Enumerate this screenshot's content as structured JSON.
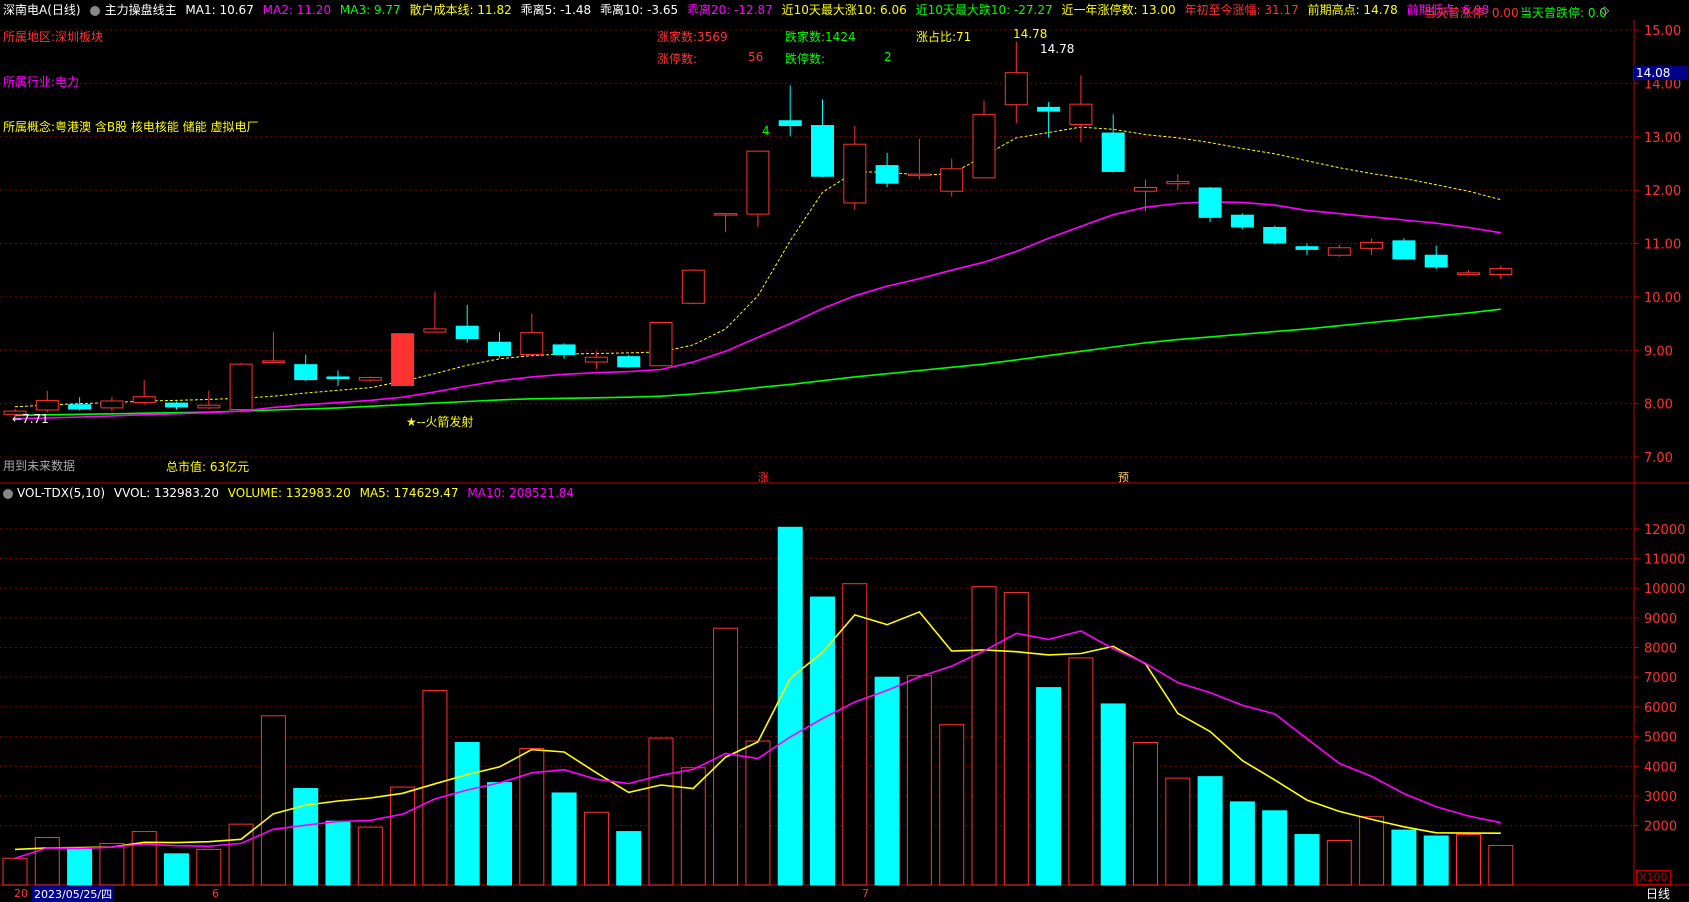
{
  "header": {
    "stock": "深南电A(日线)",
    "indicator": "主力操盘线主",
    "ma1": "MA1: 10.67",
    "ma2": "MA2: 11.20",
    "ma3": "MA3: 9.77",
    "cost": "散户成本线: 11.82",
    "bias5": "乖离5: -1.48",
    "bias10": "乖离10: -3.65",
    "bias20": "乖离20: -12.87",
    "up10": "近10天最大涨10: 6.06",
    "down10": "近10天最大跌10: -27.27",
    "limitup_year": "近一年涨停数: 13.00",
    "ytd": "年初至今涨幅: 31.17",
    "prev_high": "前期高点: 14.78",
    "prev_low": "前期低点: 6.98",
    "today_up": "当天曾涨停: 0.00",
    "today_down": "当天曾跌停: 0.0"
  },
  "info": {
    "region": "所属地区:深圳板块",
    "industry": "所属行业:电力",
    "concept": "所属概念:粤港澳 含B股 核电核能 储能 虚拟电厂",
    "up_count": "涨家数:3569",
    "down_count": "跌家数:1424",
    "ratio": "涨占比:71",
    "limit_up_label": "涨停数:",
    "limit_up_val": "56",
    "limit_down_label": "跌停数:",
    "limit_down_val": "2",
    "future_data": "用到未来数据",
    "market_cap": "总市值: 63亿元",
    "rocket": "★--火箭发射",
    "low_mark": "←7.71",
    "high_mark1": "14.78",
    "high_mark2": "14.78",
    "count4": "4",
    "zhang": "涨",
    "yu": "预",
    "price_tag": "14.08"
  },
  "vol_header": {
    "name": "VOL-TDX(5,10)",
    "vvol": "VVOL: 132983.20",
    "volume": "VOLUME: 132983.20",
    "ma5": "MA5: 174629.47",
    "ma10": "MA10: 208521.84"
  },
  "footer": {
    "date": "2023/05/25/四",
    "year_stub": "20",
    "m6": "6",
    "m7": "7",
    "period": "日线",
    "x100": "X100"
  },
  "colors": {
    "up": "#ff3232",
    "down": "#00ffff",
    "ma2": "#ff00ff",
    "ma3": "#00ff00",
    "cost": "#ffff00",
    "grid": "#800000",
    "axis": "#c00000"
  },
  "chart_data": [
    {
      "type": "candlestick",
      "ylim": [
        6.75,
        15.3
      ],
      "yticks": [
        7.0,
        8.0,
        9.0,
        10.0,
        11.0,
        12.0,
        13.0,
        14.0,
        15.0
      ],
      "candles": [
        {
          "o": 7.8,
          "c": 7.86,
          "h": 7.9,
          "l": 7.75
        },
        {
          "o": 7.88,
          "c": 8.06,
          "h": 8.24,
          "l": 7.84
        },
        {
          "o": 7.98,
          "c": 7.9,
          "h": 8.12,
          "l": 7.87
        },
        {
          "o": 7.92,
          "c": 8.05,
          "h": 8.13,
          "l": 7.86
        },
        {
          "o": 8.02,
          "c": 8.13,
          "h": 8.44,
          "l": 7.98
        },
        {
          "o": 8.01,
          "c": 7.94,
          "h": 8.04,
          "l": 7.89
        },
        {
          "o": 7.92,
          "c": 7.97,
          "h": 8.24,
          "l": 7.9
        },
        {
          "o": 7.89,
          "c": 8.74,
          "h": 8.77,
          "l": 7.83
        },
        {
          "o": 8.78,
          "c": 8.8,
          "h": 9.34,
          "l": 8.78
        },
        {
          "o": 8.73,
          "c": 8.45,
          "h": 8.92,
          "l": 8.42
        },
        {
          "o": 8.5,
          "c": 8.47,
          "h": 8.62,
          "l": 8.33
        },
        {
          "o": 8.44,
          "c": 8.49,
          "h": 8.51,
          "l": 8.41
        },
        {
          "o": 8.34,
          "c": 9.31,
          "h": 9.31,
          "l": 8.34
        },
        {
          "o": 9.34,
          "c": 9.4,
          "h": 10.1,
          "l": 9.34
        },
        {
          "o": 9.45,
          "c": 9.22,
          "h": 9.85,
          "l": 9.14
        },
        {
          "o": 9.15,
          "c": 8.9,
          "h": 9.34,
          "l": 8.86
        },
        {
          "o": 8.92,
          "c": 9.33,
          "h": 9.68,
          "l": 8.88
        },
        {
          "o": 9.1,
          "c": 8.92,
          "h": 9.13,
          "l": 8.84
        },
        {
          "o": 8.78,
          "c": 8.87,
          "h": 8.98,
          "l": 8.65
        },
        {
          "o": 8.88,
          "c": 8.69,
          "h": 8.91,
          "l": 8.67
        },
        {
          "o": 8.71,
          "c": 9.52,
          "h": 9.53,
          "l": 8.71
        },
        {
          "o": 9.88,
          "c": 10.5,
          "h": 10.52,
          "l": 9.86
        },
        {
          "o": 11.55,
          "c": 11.56,
          "h": 11.56,
          "l": 11.21
        },
        {
          "o": 11.55,
          "c": 12.73,
          "h": 12.73,
          "l": 11.31
        },
        {
          "o": 13.3,
          "c": 13.21,
          "h": 13.96,
          "l": 13.01
        },
        {
          "o": 13.21,
          "c": 12.26,
          "h": 13.7,
          "l": 12.24
        },
        {
          "o": 11.76,
          "c": 12.86,
          "h": 13.2,
          "l": 11.63
        },
        {
          "o": 12.46,
          "c": 12.13,
          "h": 12.7,
          "l": 12.06
        },
        {
          "o": 12.28,
          "c": 12.3,
          "h": 12.96,
          "l": 12.2
        },
        {
          "o": 11.98,
          "c": 12.4,
          "h": 12.59,
          "l": 11.88
        },
        {
          "o": 12.23,
          "c": 13.42,
          "h": 13.68,
          "l": 12.22
        },
        {
          "o": 13.6,
          "c": 14.2,
          "h": 14.78,
          "l": 13.25
        },
        {
          "o": 13.55,
          "c": 13.48,
          "h": 13.65,
          "l": 12.98
        },
        {
          "o": 13.23,
          "c": 13.61,
          "h": 14.15,
          "l": 12.9
        },
        {
          "o": 13.07,
          "c": 12.35,
          "h": 13.42,
          "l": 12.33
        },
        {
          "o": 11.98,
          "c": 12.05,
          "h": 12.2,
          "l": 11.6
        },
        {
          "o": 12.12,
          "c": 12.16,
          "h": 12.3,
          "l": 12.0
        },
        {
          "o": 12.04,
          "c": 11.49,
          "h": 12.06,
          "l": 11.4
        },
        {
          "o": 11.53,
          "c": 11.31,
          "h": 11.56,
          "l": 11.27
        },
        {
          "o": 11.3,
          "c": 11.01,
          "h": 11.33,
          "l": 10.98
        },
        {
          "o": 10.94,
          "c": 10.89,
          "h": 11.0,
          "l": 10.78
        },
        {
          "o": 10.78,
          "c": 10.92,
          "h": 10.98,
          "l": 10.75
        },
        {
          "o": 10.91,
          "c": 11.02,
          "h": 11.1,
          "l": 10.78
        },
        {
          "o": 11.05,
          "c": 10.71,
          "h": 11.1,
          "l": 10.7
        },
        {
          "o": 10.78,
          "c": 10.56,
          "h": 10.96,
          "l": 10.52
        },
        {
          "o": 10.45,
          "c": 10.45,
          "h": 10.5,
          "l": 10.42
        },
        {
          "o": 10.42,
          "c": 10.53,
          "h": 10.58,
          "l": 10.33
        }
      ],
      "ma3": [
        7.78,
        7.79,
        7.8,
        7.81,
        7.82,
        7.83,
        7.84,
        7.86,
        7.88,
        7.9,
        7.92,
        7.95,
        7.98,
        8.01,
        8.04,
        8.07,
        8.09,
        8.1,
        8.11,
        8.12,
        8.14,
        8.18,
        8.23,
        8.3,
        8.36,
        8.43,
        8.5,
        8.56,
        8.62,
        8.68,
        8.74,
        8.82,
        8.9,
        8.98,
        9.06,
        9.14,
        9.2,
        9.25,
        9.3,
        9.35,
        9.4,
        9.46,
        9.52,
        9.58,
        9.64,
        9.7,
        9.77
      ],
      "ma2": [
        7.72,
        7.73,
        7.75,
        7.77,
        7.79,
        7.81,
        7.83,
        7.86,
        7.93,
        7.98,
        8.02,
        8.06,
        8.12,
        8.22,
        8.33,
        8.43,
        8.5,
        8.55,
        8.58,
        8.6,
        8.64,
        8.78,
        8.98,
        9.24,
        9.5,
        9.78,
        10.02,
        10.2,
        10.34,
        10.5,
        10.65,
        10.85,
        11.1,
        11.32,
        11.54,
        11.68,
        11.75,
        11.78,
        11.77,
        11.72,
        11.62,
        11.56,
        11.5,
        11.44,
        11.38,
        11.3,
        11.2
      ],
      "cost": [
        7.94,
        7.97,
        8.0,
        8.02,
        8.05,
        8.06,
        8.08,
        8.1,
        8.14,
        8.2,
        8.25,
        8.3,
        8.42,
        8.56,
        8.72,
        8.84,
        8.9,
        8.93,
        8.94,
        8.95,
        8.97,
        9.1,
        9.4,
        10.02,
        11.05,
        11.96,
        12.34,
        12.34,
        12.28,
        12.31,
        12.64,
        12.98,
        13.08,
        13.18,
        13.14,
        13.04,
        12.98,
        12.89,
        12.78,
        12.68,
        12.55,
        12.42,
        12.31,
        12.22,
        12.1,
        11.98,
        11.82
      ]
    },
    {
      "type": "bar",
      "name": "VOL-TDX(5,10)",
      "unit": "X100",
      "ylim": [
        0,
        12700
      ],
      "yticks": [
        2000,
        3000,
        4000,
        5000,
        6000,
        7000,
        8000,
        9000,
        10000,
        11000,
        12000
      ],
      "volumes": [
        900,
        1600,
        1200,
        1400,
        1800,
        1050,
        1200,
        2050,
        5700,
        3250,
        2150,
        1950,
        3300,
        6550,
        4800,
        3450,
        4600,
        3100,
        2450,
        1800,
        4950,
        3950,
        8650,
        4850,
        12050,
        9700,
        10150,
        7000,
        7050,
        5400,
        10050,
        9850,
        6650,
        7650,
        6100,
        4800,
        3600,
        3650,
        2800,
        2500,
        1700,
        1500,
        2300,
        1850,
        1650,
        1700,
        1329.8
      ],
      "ma5": [
        1200,
        1250,
        1260,
        1280,
        1440,
        1430,
        1460,
        1540,
        2400,
        2690,
        2830,
        2930,
        3090,
        3410,
        3720,
        3980,
        4560,
        4480,
        3780,
        3120,
        3370,
        3250,
        4310,
        4820,
        6960,
        7840,
        9100,
        8770,
        9200,
        7880,
        7920,
        7860,
        7750,
        7800,
        8040,
        7450,
        5780,
        5170,
        4190,
        3540,
        2860,
        2480,
        2210,
        1960,
        1760,
        1750,
        1746
      ]
    }
  ]
}
